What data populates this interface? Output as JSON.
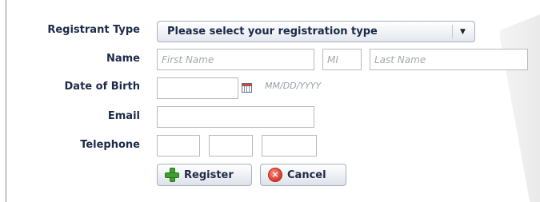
{
  "form": {
    "registrant_type_label": "Registrant Type",
    "registrant_type_value": "Please select your registration type",
    "name_label": "Name",
    "first_name_placeholder": "First Name",
    "mi_placeholder": "MI",
    "last_name_placeholder": "Last Name",
    "dob_label": "Date of Birth",
    "dob_hint": "MM/DD/YYYY",
    "email_label": "Email",
    "telephone_label": "Telephone"
  },
  "actions": {
    "register_label": "Register",
    "cancel_label": "Cancel"
  },
  "icons": {
    "dropdown": "chevron-down-icon",
    "calendar": "calendar-icon",
    "register": "plus-icon",
    "cancel": "close-icon"
  },
  "colors": {
    "label": "#1e2b4a",
    "register_icon": "#3fa02f",
    "cancel_icon": "#d8352a"
  }
}
